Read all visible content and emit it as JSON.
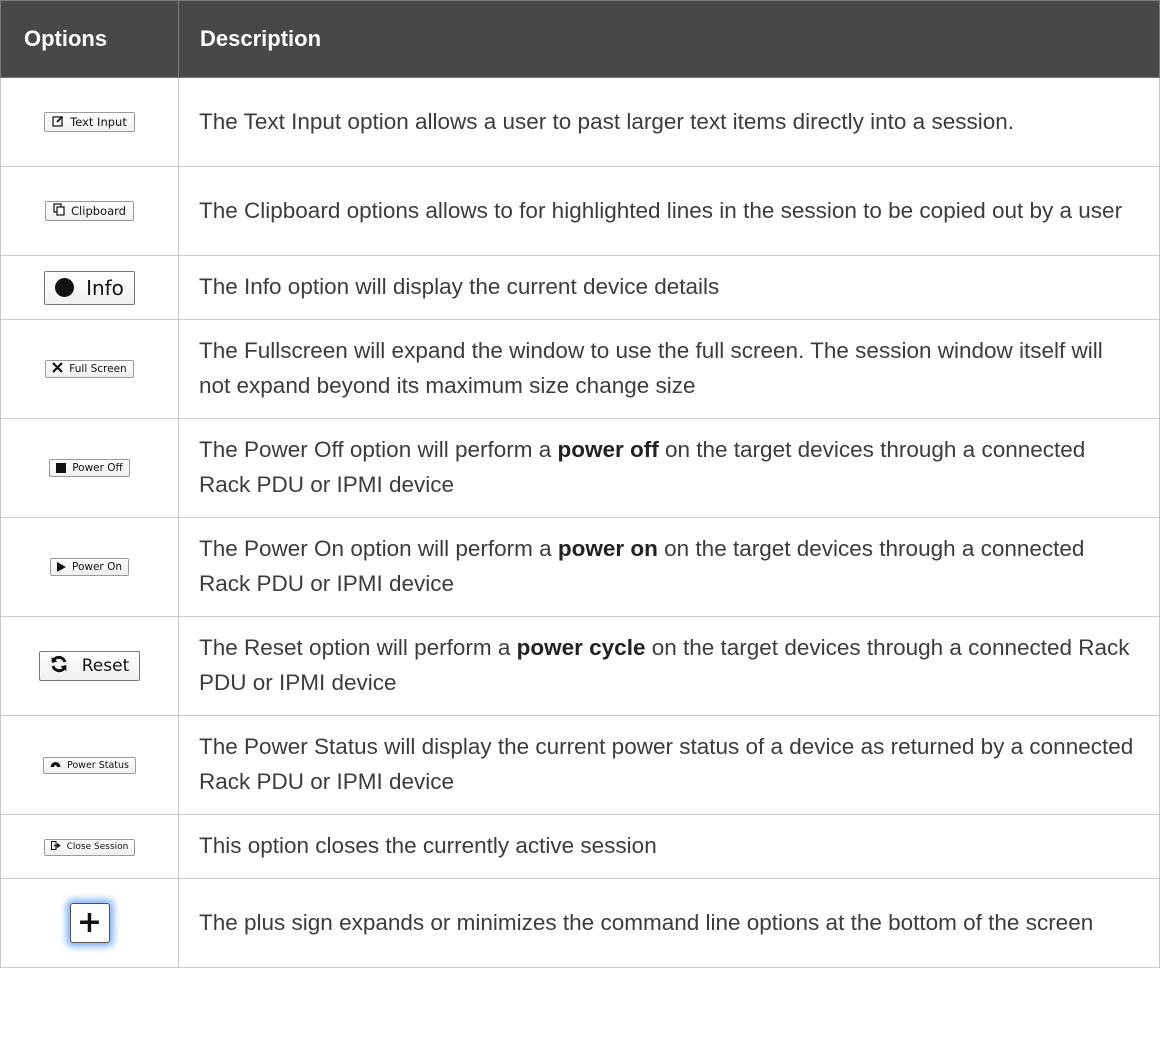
{
  "headers": {
    "options": "Options",
    "description": "Description"
  },
  "rows": [
    {
      "button": {
        "icon": "edit-icon",
        "label": "Text Input"
      },
      "desc": [
        {
          "t": "The Text Input option allows a user to past larger text items directly into a session."
        }
      ]
    },
    {
      "button": {
        "icon": "clipboard-icon",
        "label": "Clipboard"
      },
      "desc": [
        {
          "t": "The Clipboard options allows to for highlighted lines in the session to be copied out by a user"
        }
      ]
    },
    {
      "button": {
        "icon": "info-icon",
        "label": "Info"
      },
      "desc": [
        {
          "t": "The Info option will display the current device details"
        }
      ]
    },
    {
      "button": {
        "icon": "fullscreen-icon",
        "label": "Full Screen"
      },
      "desc": [
        {
          "t": "The Fullscreen will expand the window to use the full screen. The session window itself will not expand beyond its maximum size change size"
        }
      ]
    },
    {
      "button": {
        "icon": "stop-icon",
        "label": "Power Off"
      },
      "desc": [
        {
          "t": "The Power Off option will perform a "
        },
        {
          "t": "power off",
          "b": true
        },
        {
          "t": " on the target devices through a connected Rack PDU or IPMI device"
        }
      ]
    },
    {
      "button": {
        "icon": "play-icon",
        "label": "Power On"
      },
      "desc": [
        {
          "t": "The Power On option will perform a "
        },
        {
          "t": "power on",
          "b": true
        },
        {
          "t": " on the target devices through a connected Rack PDU or IPMI device"
        }
      ]
    },
    {
      "button": {
        "icon": "refresh-icon",
        "label": "Reset"
      },
      "desc": [
        {
          "t": "The Reset option will perform a "
        },
        {
          "t": "power cycle",
          "b": true
        },
        {
          "t": " on the target devices through a connected Rack PDU or IPMI device"
        }
      ]
    },
    {
      "button": {
        "icon": "dashboard-icon",
        "label": "Power Status"
      },
      "desc": [
        {
          "t": "The Power Status will display the current power status of a device as returned by a connected Rack PDU or IPMI device"
        }
      ]
    },
    {
      "button": {
        "icon": "sign-out-icon",
        "label": "Close Session"
      },
      "desc": [
        {
          "t": "This option closes the currently active session"
        }
      ]
    },
    {
      "button": {
        "icon": "plus-icon",
        "label": ""
      },
      "desc": [
        {
          "t": "The plus sign expands or minimizes the command line options at the bottom of the screen"
        }
      ]
    }
  ]
}
